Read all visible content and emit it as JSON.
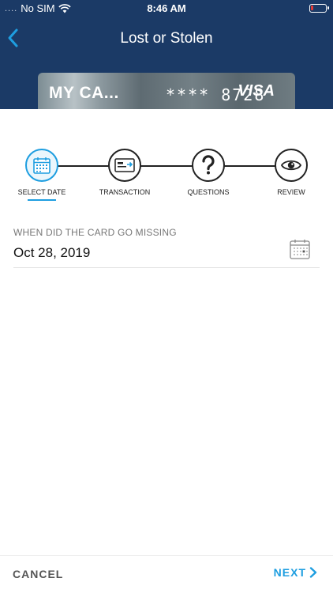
{
  "status_bar": {
    "signal": "....",
    "carrier": "No SIM",
    "time": "8:46 AM"
  },
  "nav": {
    "title": "Lost or Stolen",
    "back_icon": "chevron-left-icon"
  },
  "card": {
    "name": "MY CA...",
    "number_mask": "****",
    "number_last4": "8728",
    "brand": "VISA"
  },
  "steps": [
    {
      "label": "SELECT DATE",
      "icon": "calendar-icon",
      "active": true
    },
    {
      "label": "TRANSACTION",
      "icon": "credit-card-icon",
      "active": false
    },
    {
      "label": "QUESTIONS",
      "icon": "question-icon",
      "active": false
    },
    {
      "label": "REVIEW",
      "icon": "eye-icon",
      "active": false
    }
  ],
  "form": {
    "date_label": "WHEN DID THE CARD GO MISSING",
    "date_value": "Oct 28, 2019",
    "calendar_icon": "calendar-icon"
  },
  "footer": {
    "cancel_label": "CANCEL",
    "next_label": "NEXT",
    "next_icon": "chevron-right-icon"
  },
  "colors": {
    "header_bg": "#1b3a66",
    "accent": "#1e9ee0",
    "battery_low": "#e53935"
  }
}
